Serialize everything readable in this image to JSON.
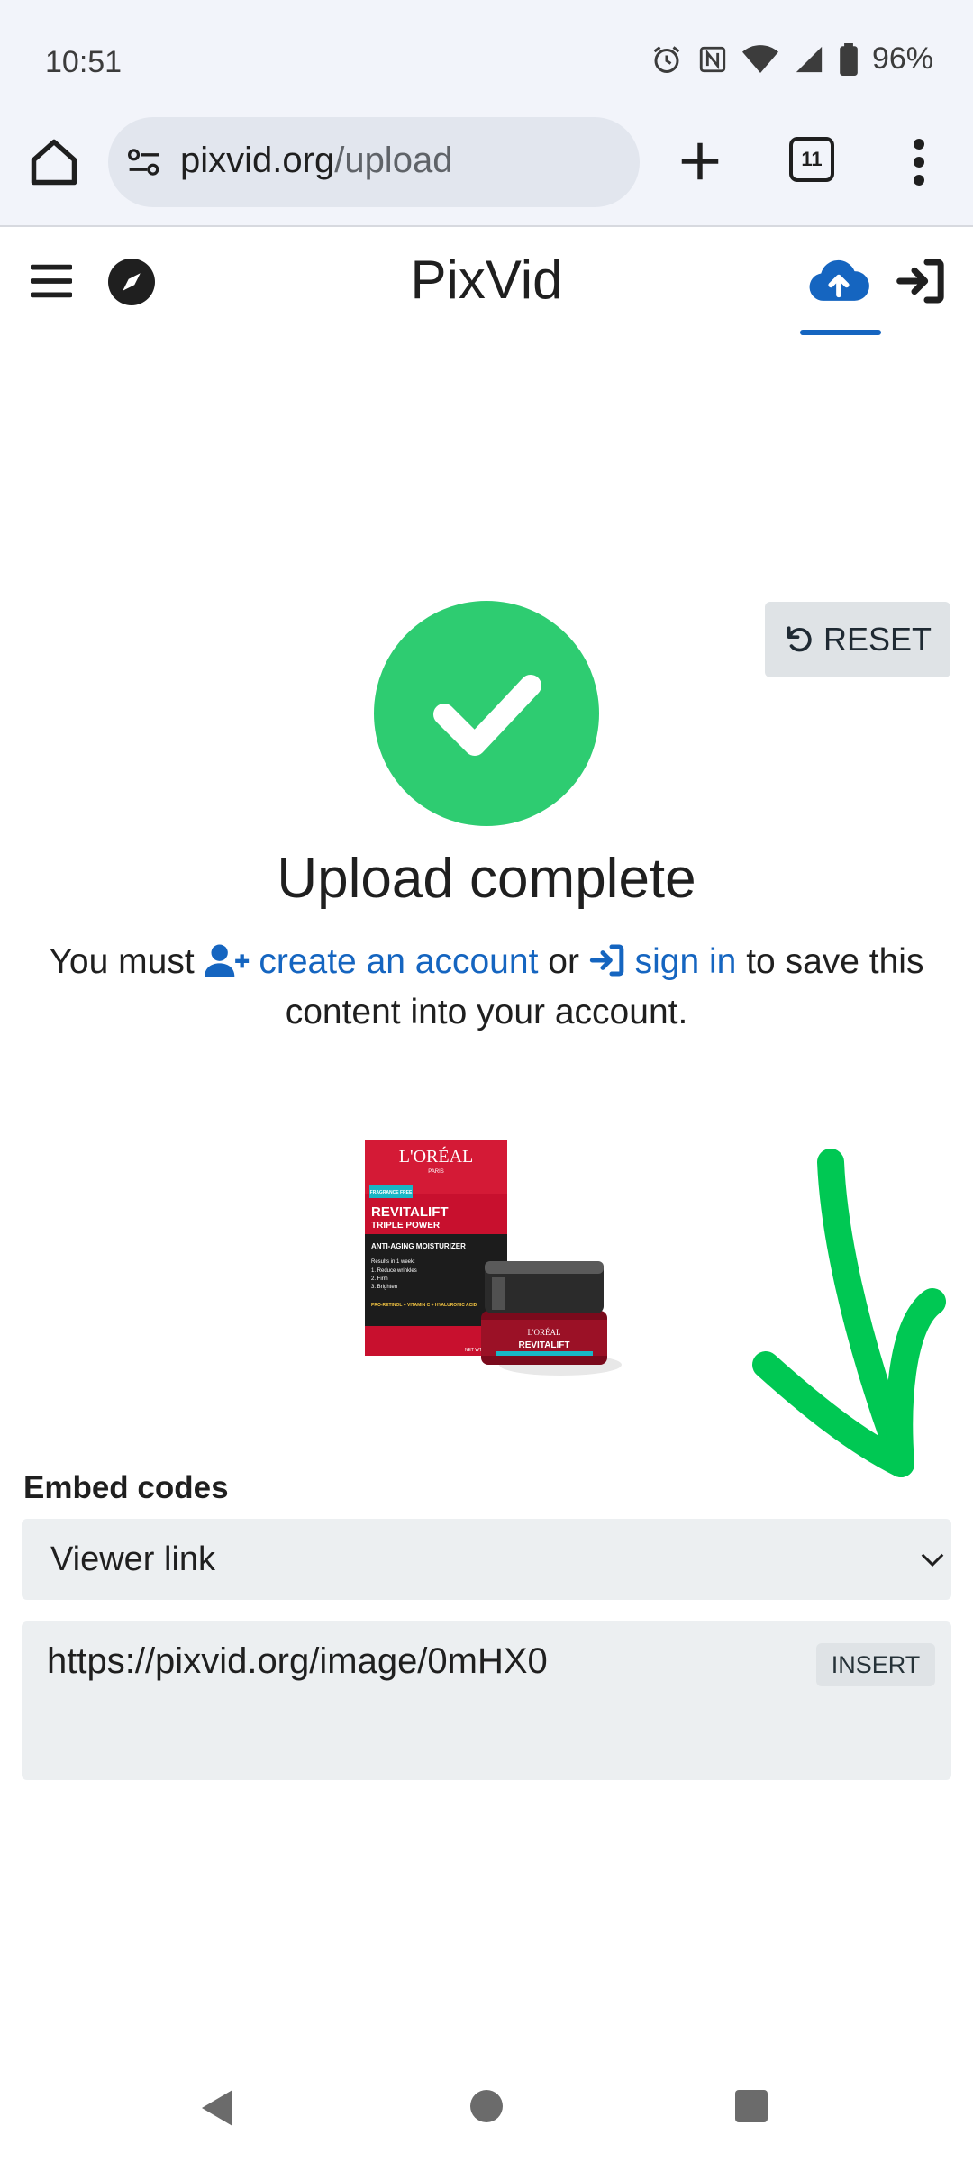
{
  "status_bar": {
    "time": "10:51",
    "battery": "96%",
    "icons": [
      "alarm-icon",
      "nfc-icon",
      "wifi-icon",
      "signal-icon",
      "battery-icon"
    ]
  },
  "browser": {
    "url_domain": "pixvid.org",
    "url_path": "/upload",
    "tab_count": "11",
    "icons": [
      "home-icon",
      "site-settings-icon",
      "plus-icon",
      "tab-switcher-icon",
      "more-vert-icon"
    ]
  },
  "site": {
    "title": "PixVid",
    "icons": [
      "menu-icon",
      "compass-icon",
      "cloud-upload-icon",
      "sign-in-icon"
    ]
  },
  "reset": {
    "label": "RESET"
  },
  "upload": {
    "title": "Upload complete",
    "notice_prefix": "You must",
    "create_link": "create an account",
    "or_text": "or",
    "signin_link": "sign in",
    "notice_suffix": "to save this content into your account."
  },
  "product_image": {
    "brand": "L'ORÉAL",
    "brand_sub": "PARIS",
    "fragrance": "FRAGRANCE FREE",
    "product": "REVITALIFT",
    "product_sub": "TRIPLE POWER",
    "tagline": "ANTI-AGING MOISTURIZER",
    "results": "Results in 1 week:",
    "bullets": [
      "1. Reduce wrinkles",
      "2. Firm",
      "3. Brighten"
    ],
    "ingredients": "PRO-RETINOL + VITAMIN C + HYALURONIC ACID",
    "net_wt": "NET WT 1.7 OZ",
    "jar_brand": "L'ORÉAL",
    "jar_product": "REVITALIFT"
  },
  "embed": {
    "label": "Embed codes",
    "selected": "Viewer link",
    "code": "https://pixvid.org/image/0mHX0",
    "insert_label": "INSERT"
  },
  "colors": {
    "accent": "#1565c0",
    "success": "#2ecc71",
    "annotation": "#00c853"
  }
}
